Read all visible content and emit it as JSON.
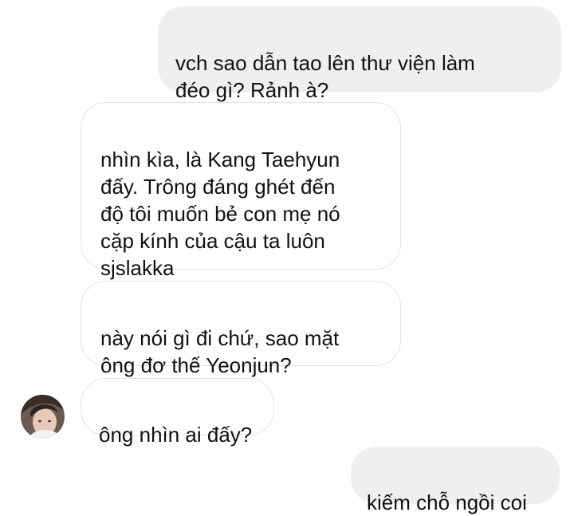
{
  "conversation": {
    "messages": [
      {
        "sender": "me",
        "text": "vch sao dẫn tao lên thư viện làm\nđéo gì? Rảnh à?"
      },
      {
        "sender": "other",
        "text": "nhìn kìa, là Kang Taehyun\nđấy. Trông đáng ghét đến\nđộ tôi muốn bẻ con mẹ nó\ncặp kính của cậu ta luôn\nsjslakka"
      },
      {
        "sender": "other",
        "text": "này nói gì đi chứ, sao mặt\nông đơ thế Yeonjun?"
      },
      {
        "sender": "other",
        "text": "ông nhìn ai đấy?"
      },
      {
        "sender": "me",
        "text": "kiếm chỗ ngồi coi"
      }
    ]
  },
  "colors": {
    "outgoing_bubble": "#efefef",
    "incoming_bubble": "#ffffff",
    "incoming_border": "#e2e2e2",
    "text": "#111111"
  },
  "icons": {
    "avatar": "contact-avatar-photo"
  }
}
